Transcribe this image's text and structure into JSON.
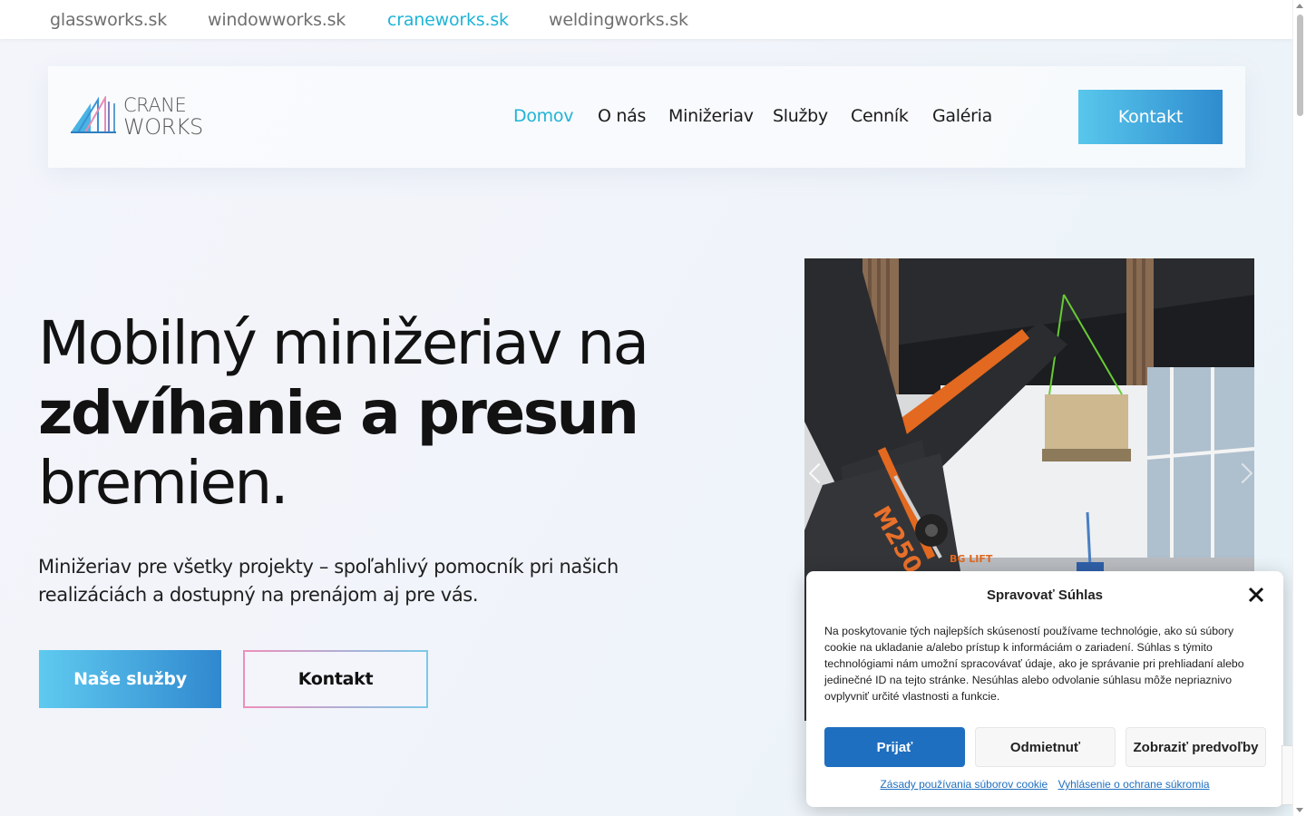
{
  "sites_bar": {
    "links": [
      "glassworks.sk",
      "windowworks.sk",
      "craneworks.sk",
      "weldingworks.sk"
    ],
    "active": "craneworks.sk"
  },
  "header": {
    "logo_line1": "CRANE",
    "logo_line2": "WORKS",
    "nav": [
      "Domov",
      "O nás",
      "Minižeriav",
      "Služby",
      "Cenník",
      "Galéria"
    ],
    "nav_active": "Domov",
    "cta": "Kontakt"
  },
  "hero": {
    "title_line1": "Mobilný minižeriav na",
    "title_line2": "zdvíhanie a presun",
    "title_line3": "bremien.",
    "subtitle": "Minižeriav pre všetky projekty – spoľahlivý pomocník pri našich realizáciách a dostupný na prenájom aj pre vás.",
    "btn_primary": "Naše služby",
    "btn_secondary": "Kontakt"
  },
  "carousel": {
    "crane_model": "M250",
    "crane_brand": "BG LIFT"
  },
  "cookie": {
    "title": "Spravovať Súhlas",
    "text": "Na poskytovanie tých najlepších skúseností používame technológie, ako sú súbory cookie na ukladanie a/alebo prístup k informáciám o zariadení. Súhlas s týmito technológiami nám umožní spracovávať údaje, ako je správanie pri prehliadaní alebo jedinečné ID na tejto stránke. Nesúhlas alebo odvolanie súhlasu môže nepriaznivo ovplyvniť určité vlastnosti a funkcie.",
    "accept": "Prijať",
    "deny": "Odmietnuť",
    "prefs": "Zobraziť predvoľby",
    "link_cookies": "Zásady používania súborov cookie",
    "link_privacy": "Vyhlásenie o ochrane súkromia"
  },
  "colors": {
    "accent": "#1fb4d6",
    "button_gradient_start": "#58c7ec",
    "button_gradient_end": "#2f8ccf",
    "cookie_accept": "#1f6fc0"
  }
}
